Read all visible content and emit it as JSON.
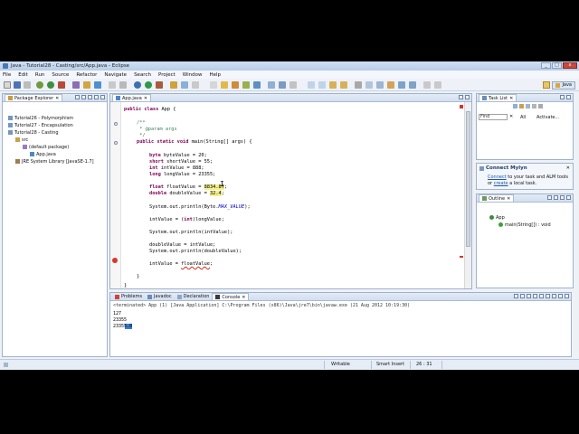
{
  "window": {
    "title": "Java - Tutorial28 - Casting/src/App.java - Eclipse"
  },
  "menu": [
    "File",
    "Edit",
    "Run",
    "Source",
    "Refactor",
    "Navigate",
    "Search",
    "Project",
    "Window",
    "Help"
  ],
  "perspective": {
    "label": "Java"
  },
  "package_explorer": {
    "tab_label": "Package Explorer",
    "items": [
      {
        "label": "Tutorial26 - Polymorphism",
        "icon": "project-icon"
      },
      {
        "label": "Tutorial27 - Encapsulation",
        "icon": "project-icon"
      },
      {
        "label": "Tutorial28 - Casting",
        "icon": "project-icon"
      },
      {
        "label": "src",
        "icon": "source-folder-icon"
      },
      {
        "label": "(default package)",
        "icon": "package-icon"
      },
      {
        "label": "App.java",
        "icon": "java-file-icon"
      },
      {
        "label": "JRE System Library [JavaSE-1.7]",
        "icon": "library-icon"
      }
    ]
  },
  "editor": {
    "tab_label": "App.java",
    "code": {
      "l1_kw": "public class ",
      "l1_rest": "App {",
      "l2": "/**",
      "l3": " * @param args",
      "l4": " */",
      "l5_kw": "public static void ",
      "l5_rest": "main(String[] args) {",
      "l6_kw": "byte ",
      "l6_rest": "byteValue = 20;",
      "l7_kw": "short ",
      "l7_rest": "shortValue = 55;",
      "l8_kw": "int ",
      "l8_rest": "intValue = 888;",
      "l9_kw": "long ",
      "l9_rest": "longValue = 23355;",
      "l10_kw": "float ",
      "l10_rest": "floatValue = ",
      "l10_num": "8834.8f",
      "l10_end": ";",
      "l11_kw": "double ",
      "l11_rest": "doubleValue = ",
      "l11_num": "32.4",
      "l11_end": ";",
      "l12_pre": "System.out.println(Byte.",
      "l12_it": "MAX_VALUE",
      "l12_end": ");",
      "l13_pre": "intValue = (",
      "l13_kw": "int",
      "l13_end": ")longValue;",
      "l14": "System.out.println(intValue);",
      "l15": "doubleValue = intValue;",
      "l16": "System.out.println(doubleValue);",
      "l17_pre": "intValue = ",
      "l17_err": "floatValue",
      "l17_end": ";",
      "l18": "}",
      "l19": "}"
    }
  },
  "task_list": {
    "tab_label": "Task List",
    "search_placeholder": "Find",
    "filter_all": "All",
    "activate": "Activate..."
  },
  "mylyn": {
    "title": "Connect Mylyn",
    "line1_link": "Connect",
    "line1_rest": " to your task and ALM tools",
    "line2_pre": "or ",
    "line2_link": "create",
    "line2_rest": " a local task."
  },
  "outline": {
    "tab_label": "Outline",
    "items": [
      {
        "label": "App"
      },
      {
        "label": "main(String[]) : void"
      }
    ]
  },
  "bottom_tabs": [
    "Problems",
    "Javadoc",
    "Declaration",
    "Console"
  ],
  "console": {
    "header": "<terminated> App (1) [Java Application] C:\\Program Files (x86)\\Java\\jre7\\bin\\javaw.exe (21 Aug 2012 10:19:30)",
    "lines": [
      "127",
      "23355",
      "23355.0"
    ]
  },
  "status": {
    "mode": "Writable",
    "insert": "Smart Insert",
    "position": "26 : 31"
  }
}
